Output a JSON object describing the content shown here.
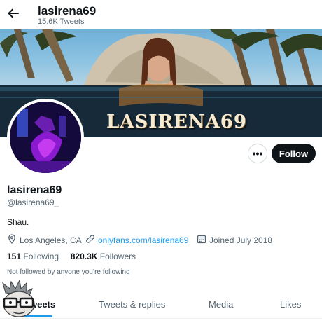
{
  "header": {
    "title": "lasirena69",
    "subtitle": "15.6K Tweets",
    "back_icon": "arrow-left-icon"
  },
  "banner": {
    "text": "LASIRENA69"
  },
  "profile": {
    "name": "lasirena69",
    "handle": "@lasirena69_",
    "bio": "Shau.",
    "location": "Los Angeles, CA",
    "link": "onlyfans.com/lasirena69",
    "joined": "Joined July 2018",
    "following_count": "151",
    "following_label": "Following",
    "followers_count": "820.3K",
    "followers_label": "Followers",
    "not_followed": "Not followed by anyone you’re following"
  },
  "actions": {
    "more_label": "•••",
    "follow_label": "Follow"
  },
  "tabs": [
    {
      "label": "Tweets",
      "active": true
    },
    {
      "label": "Tweets & replies",
      "active": false
    },
    {
      "label": "Media",
      "active": false
    },
    {
      "label": "Likes",
      "active": false
    }
  ],
  "colors": {
    "accent": "#1d9bf0",
    "text": "#0f1419",
    "secondary": "#536471",
    "follow_bg": "#0f1419"
  }
}
